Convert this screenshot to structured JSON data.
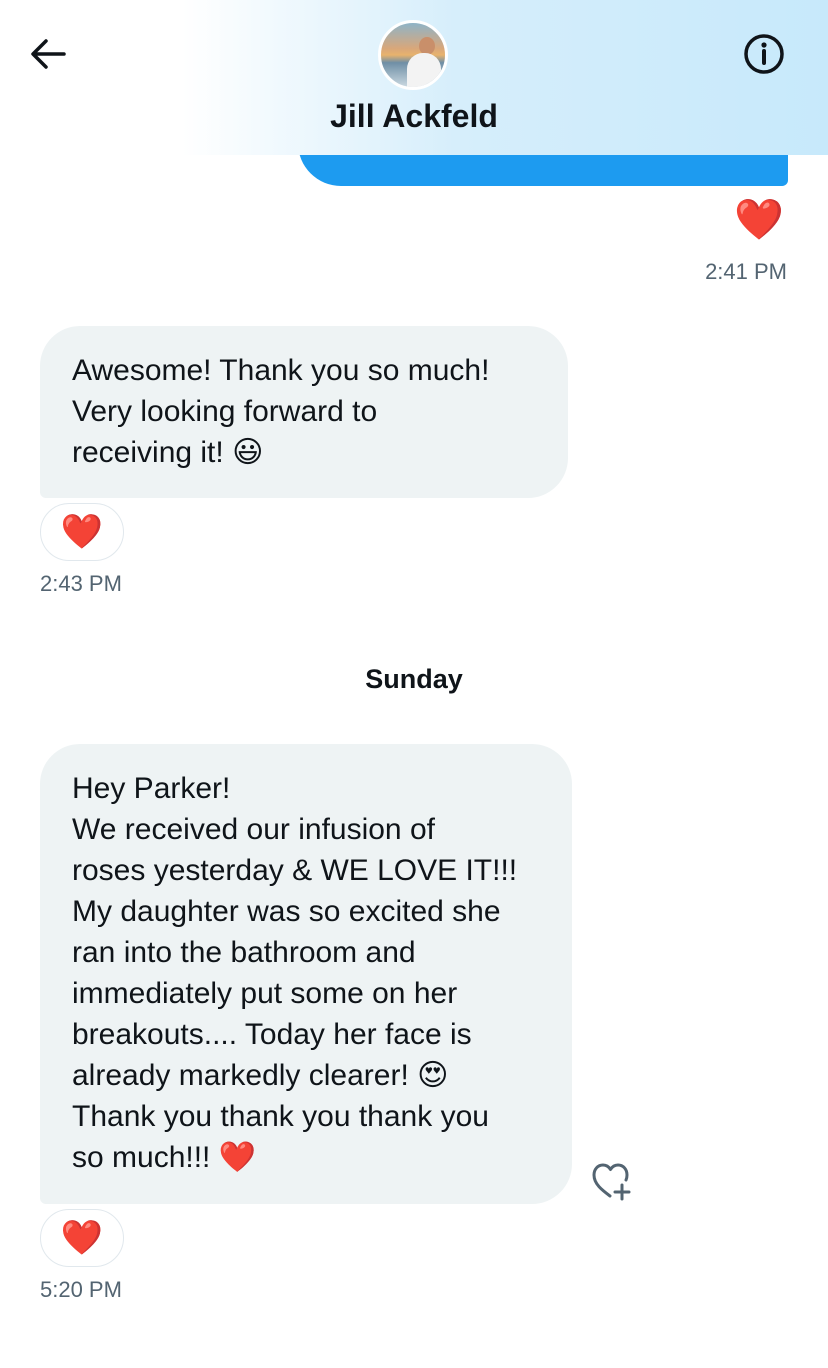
{
  "header": {
    "contact_name": "Jill Ackfeld",
    "back_icon": "back-arrow-icon",
    "info_icon": "info-icon"
  },
  "messages": [
    {
      "direction": "outgoing",
      "reaction": "❤️",
      "time": "2:41 PM"
    },
    {
      "direction": "incoming",
      "lines": [
        "Awesome!  Thank you so much!",
        "Very looking forward to",
        "receiving it!  😃"
      ],
      "reaction": "❤️",
      "time": "2:43 PM"
    },
    {
      "direction": "incoming",
      "lines": [
        "Hey Parker!",
        "We received our infusion of",
        "roses yesterday & WE LOVE IT!!!",
        "My daughter was so excited she",
        "ran into the bathroom and",
        "immediately put some on her",
        "breakouts.... Today her face is",
        "already markedly clearer!  😍",
        "Thank you thank you thank you",
        "so much!!!  ❤️"
      ],
      "reaction": "❤️",
      "time": "5:20 PM"
    }
  ],
  "day_separator": "Sunday",
  "colors": {
    "accent_blue": "#1d9bf0",
    "incoming_bubble": "#eef3f4",
    "secondary_text": "#536471"
  }
}
